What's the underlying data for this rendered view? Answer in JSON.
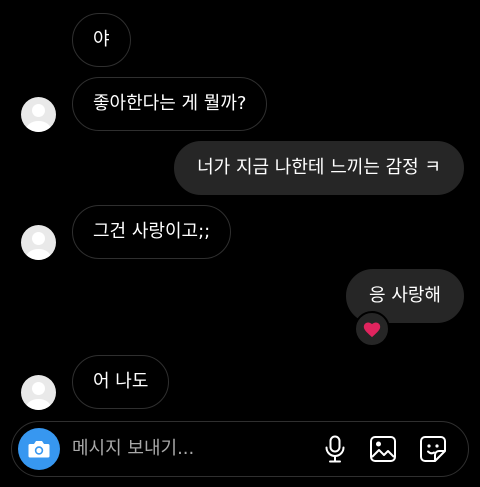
{
  "messages": [
    {
      "direction": "incoming",
      "text": "야",
      "avatar": false
    },
    {
      "direction": "incoming",
      "text": "좋아한다는 게 뭘까?",
      "avatar": true
    },
    {
      "direction": "outgoing",
      "text": "너가 지금 나한테 느끼는 감정 ㅋ"
    },
    {
      "direction": "incoming",
      "text": "그건 사랑이고;;",
      "avatar": true
    },
    {
      "direction": "outgoing",
      "text": "응 사랑해",
      "reaction": "heart-icon"
    },
    {
      "direction": "incoming",
      "text": "어 나도",
      "avatar": true
    }
  ],
  "composer": {
    "placeholder": "메시지 보내기...",
    "icons": [
      "camera-icon",
      "microphone-icon",
      "gallery-icon",
      "sticker-icon"
    ]
  },
  "colors": {
    "background": "#000000",
    "incoming_border": "#2f2f2f",
    "outgoing_bubble": "#262626",
    "camera_button": "#3797f0",
    "heart": "#e0245e"
  }
}
